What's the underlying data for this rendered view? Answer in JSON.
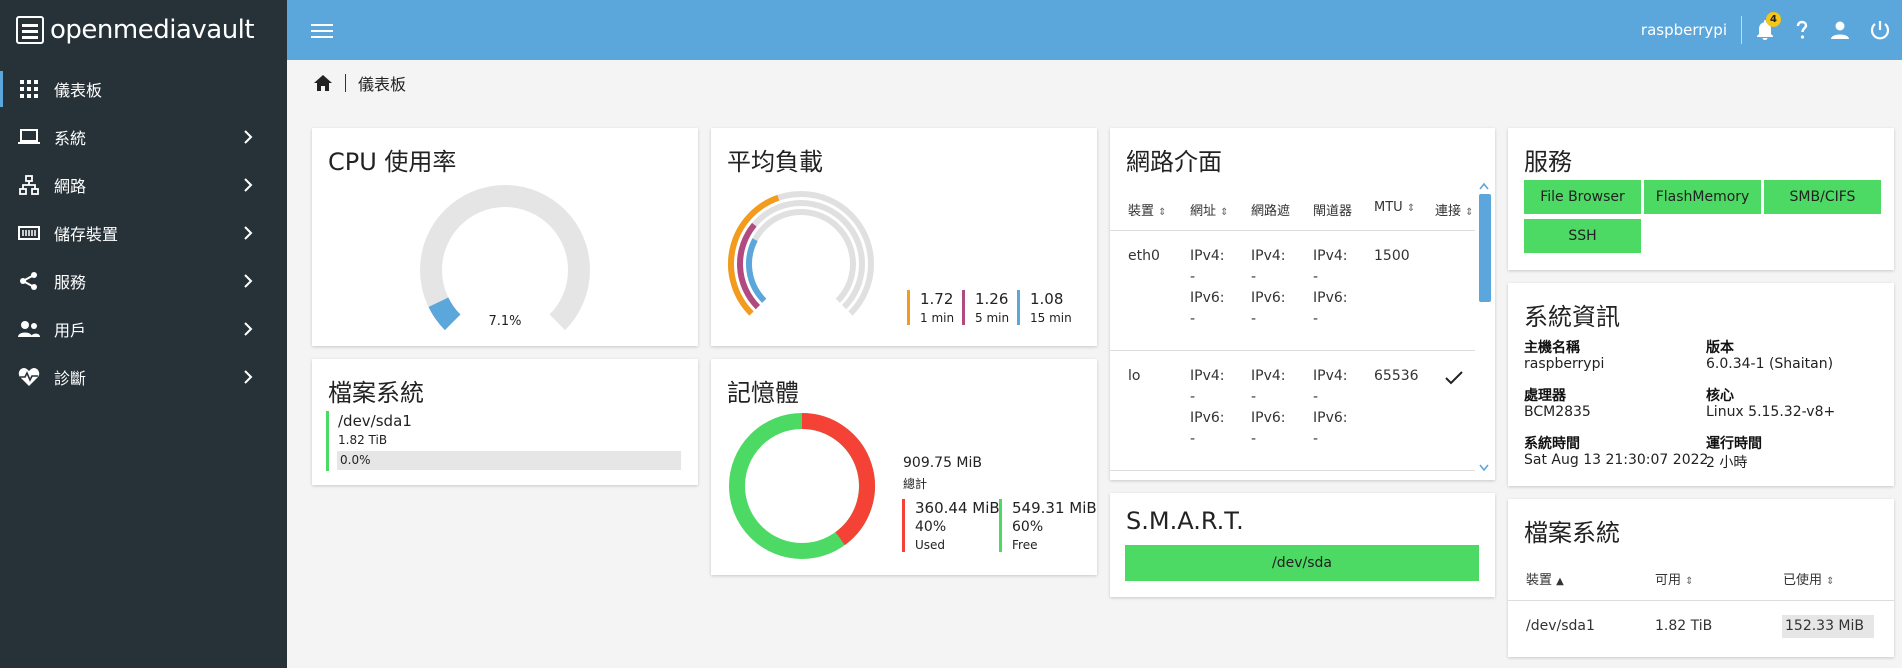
{
  "brand": {
    "name": "openmediavault"
  },
  "sidebar": {
    "items": [
      {
        "label": "儀表板",
        "icon": "dashboard-grid-icon",
        "active": true,
        "has_children": false
      },
      {
        "label": "系統",
        "icon": "laptop-icon",
        "has_children": true
      },
      {
        "label": "網路",
        "icon": "network-icon",
        "has_children": true
      },
      {
        "label": "儲存裝置",
        "icon": "storage-icon",
        "has_children": true
      },
      {
        "label": "服務",
        "icon": "share-icon",
        "has_children": true
      },
      {
        "label": "用戶",
        "icon": "users-icon",
        "has_children": true
      },
      {
        "label": "診斷",
        "icon": "heart-pulse-icon",
        "has_children": true
      }
    ]
  },
  "topbar": {
    "hostname": "raspberrypi",
    "notification_count": "4",
    "icons": [
      "menu-icon",
      "bell-icon",
      "help-icon",
      "user-icon",
      "power-icon"
    ],
    "background": "#5ba7db"
  },
  "breadcrumb": {
    "current": "儀表板"
  },
  "cpu": {
    "title": "CPU 使用率",
    "value_label": "7.1%",
    "value": 7.1
  },
  "load": {
    "title": "平均負載",
    "items": [
      {
        "value": "1.72",
        "label": "1 min",
        "color": "#f29b1d"
      },
      {
        "value": "1.26",
        "label": "5 min",
        "color": "#b04a7f"
      },
      {
        "value": "1.08",
        "label": "15 min",
        "color": "#5ba7db"
      }
    ]
  },
  "network": {
    "title": "網路介面",
    "headers": [
      "裝置",
      "網址",
      "網路遮",
      "閘道器",
      "MTU",
      "連接"
    ],
    "rows": [
      {
        "device": "eth0",
        "address": [
          "IPv4:",
          "-",
          "IPv6:",
          "-"
        ],
        "netmask": [
          "IPv4:",
          "-",
          "IPv6:",
          "-"
        ],
        "gateway": [
          "IPv4:",
          "-",
          "IPv6:",
          "-"
        ],
        "mtu": "1500",
        "link": ""
      },
      {
        "device": "lo",
        "address": [
          "IPv4:",
          "-",
          "IPv6:",
          "-"
        ],
        "netmask": [
          "IPv4:",
          "-",
          "IPv6:",
          "-"
        ],
        "gateway": [
          "IPv4:",
          "-",
          "IPv6:",
          "-"
        ],
        "mtu": "65536",
        "link": "check-icon"
      }
    ]
  },
  "services": {
    "title": "服務",
    "items": [
      "File Browser",
      "FlashMemory",
      "SMB/CIFS",
      "SSH"
    ],
    "color": "#4cd964"
  },
  "filesystem_left": {
    "title": "檔案系統",
    "device": "/dev/sda1",
    "size": "1.82 TiB",
    "usage": "0.0%",
    "usage_value": 0.0
  },
  "memory": {
    "title": "記憶體",
    "total_value": "909.75 MiB",
    "total_label": "總計",
    "used_value": "360.44 MiB",
    "used_pct": "40%",
    "used_label": "Used",
    "free_value": "549.31 MiB",
    "free_pct": "60%",
    "free_label": "Free",
    "used_fraction": 0.4,
    "used_color": "#f44336",
    "free_color": "#4cd964"
  },
  "smart": {
    "title": "S.M.A.R.T.",
    "device": "/dev/sda"
  },
  "sysinfo": {
    "title": "系統資訊",
    "fields": [
      {
        "label": "主機名稱",
        "value": "raspberrypi"
      },
      {
        "label": "版本",
        "value": "6.0.34-1 (Shaitan)"
      },
      {
        "label": "處理器",
        "value": "BCM2835"
      },
      {
        "label": "核心",
        "value": "Linux 5.15.32-v8+"
      },
      {
        "label": "系統時間",
        "value": "Sat Aug 13 21:30:07 2022"
      },
      {
        "label": "運行時間",
        "value": "2 小時"
      }
    ]
  },
  "filesystem_right": {
    "title": "檔案系統",
    "headers": [
      "裝置",
      "可用",
      "已使用"
    ],
    "rows": [
      {
        "device": "/dev/sda1",
        "available": "1.82 TiB",
        "used": "152.33 MiB"
      }
    ]
  }
}
